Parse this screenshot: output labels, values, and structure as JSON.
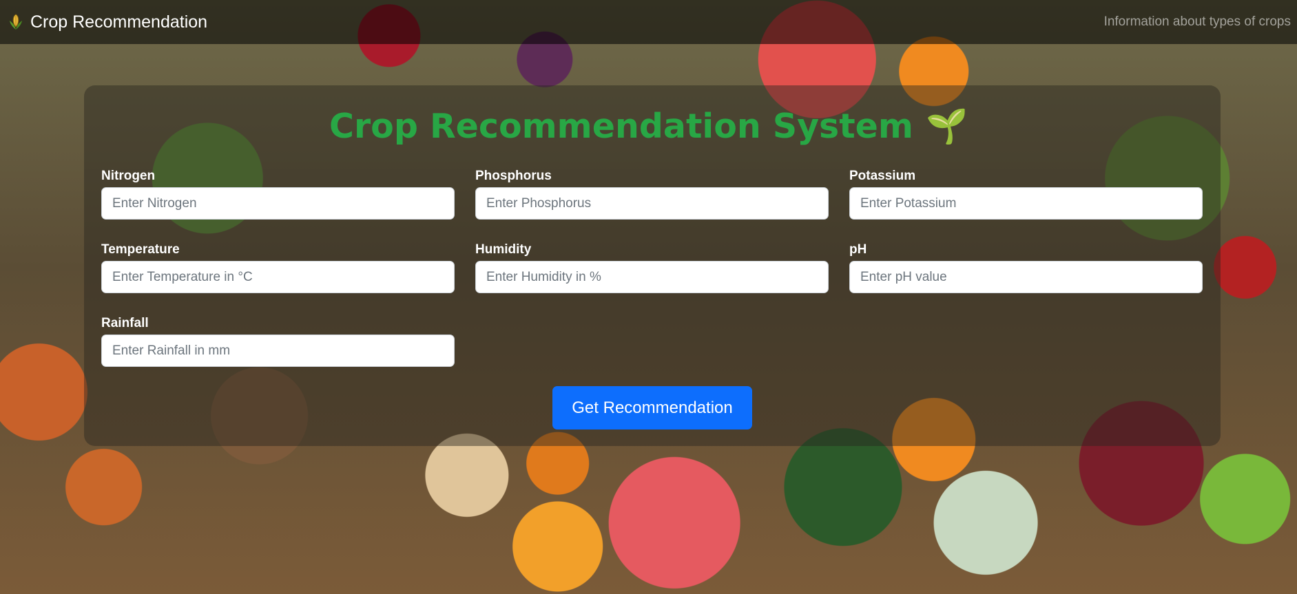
{
  "navbar": {
    "brand_icon": "corn-icon",
    "brand": "Crop Recommendation",
    "link": "Information about types of crops"
  },
  "form": {
    "title": "Crop Recommendation System",
    "title_icon": "🌱",
    "fields": [
      {
        "label": "Nitrogen",
        "placeholder": "Enter Nitrogen"
      },
      {
        "label": "Phosphorus",
        "placeholder": "Enter Phosphorus"
      },
      {
        "label": "Potassium",
        "placeholder": "Enter Potassium"
      },
      {
        "label": "Temperature",
        "placeholder": "Enter Temperature in °C"
      },
      {
        "label": "Humidity",
        "placeholder": "Enter Humidity in %"
      },
      {
        "label": "pH",
        "placeholder": "Enter pH value"
      },
      {
        "label": "Rainfall",
        "placeholder": "Enter Rainfall in mm"
      }
    ],
    "submit_label": "Get Recommendation"
  },
  "colors": {
    "title": "#28a745",
    "button": "#0d6efd"
  }
}
